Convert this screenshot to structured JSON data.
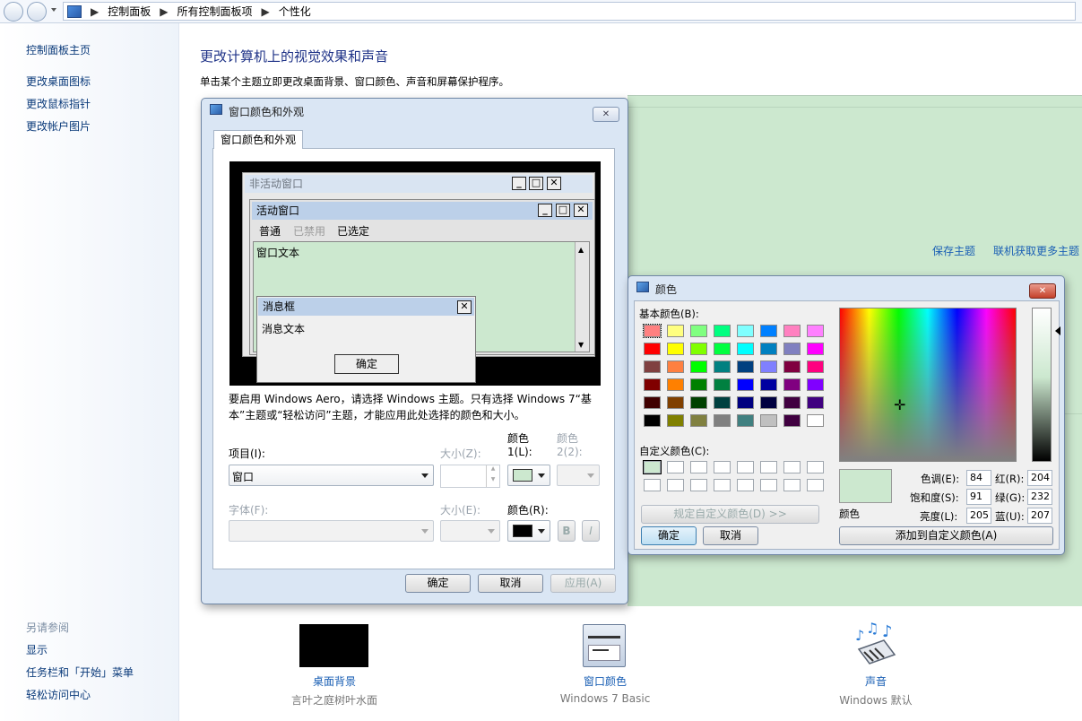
{
  "breadcrumb": {
    "items": [
      "控制面板",
      "所有控制面板项",
      "个性化"
    ]
  },
  "left_pane": {
    "links": [
      "控制面板主页",
      "更改桌面图标",
      "更改鼠标指针",
      "更改帐户图片"
    ],
    "see_also_title": "另请参阅",
    "see_also": [
      "显示",
      "任务栏和「开始」菜单",
      "轻松访问中心"
    ]
  },
  "main": {
    "title": "更改计算机上的视觉效果和声音",
    "subtitle": "单击某个主题立即更改桌面背景、窗口颜色、声音和屏幕保护程序。",
    "save_theme": "保存主题",
    "get_more": "联机获取更多主题"
  },
  "bottom": [
    {
      "label": "桌面背景",
      "sub": "言叶之庭树叶水面"
    },
    {
      "label": "窗口颜色",
      "sub": "Windows 7 Basic"
    },
    {
      "label": "声音",
      "sub": "Windows 默认"
    }
  ],
  "appearance": {
    "title": "窗口颜色和外观",
    "tab": "窗口颜色和外观",
    "preview": {
      "inactive": "非活动窗口",
      "active": "活动窗口",
      "menu_normal": "普通",
      "menu_disabled": "已禁用",
      "menu_selected": "已选定",
      "window_text": "窗口文本",
      "msgbox": "消息框",
      "msg_text": "消息文本",
      "ok": "确定"
    },
    "note": "要启用 Windows Aero，请选择 Windows 主题。只有选择 Windows 7“基本”主题或“轻松访问”主题，才能应用此处选择的颜色和大小。",
    "item_label": "项目(I):",
    "item_value": "窗口",
    "size_label": "大小(Z):",
    "color1_label": "颜色",
    "color1_label2": "1(L):",
    "color2_label": "颜色",
    "color2_label2": "2(2):",
    "font_label": "字体(F):",
    "size2_label": "大小(E):",
    "color_label": "颜色(R):",
    "bold": "B",
    "italic": "I",
    "ok": "确定",
    "cancel": "取消",
    "apply": "应用(A)",
    "color1_value": "#cce8cf",
    "font_color_value": "#000000"
  },
  "color_dialog": {
    "title": "颜色",
    "basic_label": "基本颜色(B):",
    "custom_label": "自定义颜色(C):",
    "define_custom": "规定自定义颜色(D) >>",
    "ok": "确定",
    "cancel": "取消",
    "add_custom": "添加到自定义颜色(A)",
    "solid_label": "颜色",
    "hue_label": "色调(E):",
    "hue": "84",
    "sat_label": "饱和度(S):",
    "sat": "91",
    "lum_label": "亮度(L):",
    "lum": "205",
    "red_label": "红(R):",
    "red": "204",
    "green_label": "绿(G):",
    "green": "232",
    "blue_label": "蓝(U):",
    "blue": "207",
    "selected_color": "#cce8cf",
    "basic_colors": [
      "#ff8080",
      "#ffff80",
      "#80ff80",
      "#00ff80",
      "#80ffff",
      "#0080ff",
      "#ff80c0",
      "#ff80ff",
      "#ff0000",
      "#ffff00",
      "#80ff00",
      "#00ff40",
      "#00ffff",
      "#0080c0",
      "#8080c0",
      "#ff00ff",
      "#804040",
      "#ff8040",
      "#00ff00",
      "#008080",
      "#004080",
      "#8080ff",
      "#800040",
      "#ff0080",
      "#800000",
      "#ff8000",
      "#008000",
      "#008040",
      "#0000ff",
      "#0000a0",
      "#800080",
      "#8000ff",
      "#400000",
      "#804000",
      "#004000",
      "#004040",
      "#000080",
      "#000040",
      "#400040",
      "#400080",
      "#000000",
      "#808000",
      "#808040",
      "#808080",
      "#408080",
      "#c0c0c0",
      "#400040",
      "#ffffff"
    ]
  }
}
